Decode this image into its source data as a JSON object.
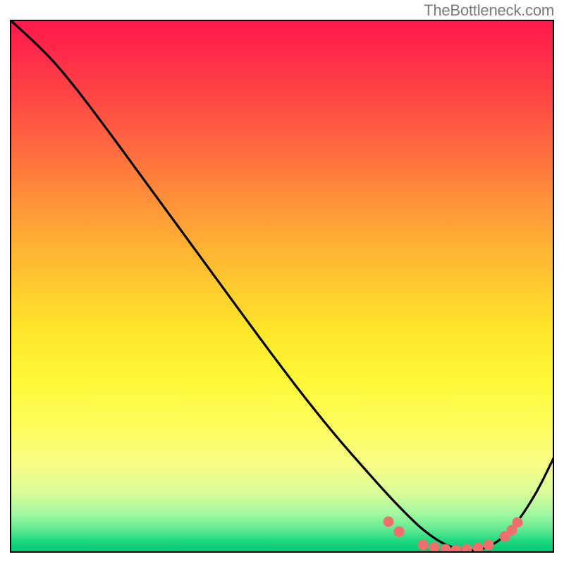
{
  "watermark": {
    "text": "TheBottleneck.com"
  },
  "colors": {
    "border": "#000000",
    "curve": "#000000",
    "dot": "#ef6f6d",
    "gradient_top": "#ff1a4a",
    "gradient_bottom": "#00c873"
  },
  "chart_data": {
    "type": "line",
    "title": "",
    "xlabel": "",
    "ylabel": "",
    "xlim": [
      0,
      100
    ],
    "ylim": [
      0,
      100
    ],
    "grid": false,
    "legend": false,
    "series": [
      {
        "name": "bottleneck-curve",
        "x": [
          0,
          4,
          7,
          10,
          14,
          18,
          22,
          27,
          32,
          38,
          45,
          52,
          58,
          63,
          67,
          71,
          75,
          79,
          83,
          86,
          89,
          92,
          95,
          98,
          100
        ],
        "y": [
          100,
          98,
          96,
          93,
          89,
          84,
          78,
          71,
          64,
          56,
          46,
          36,
          27,
          19,
          12,
          7,
          3,
          1,
          0,
          0,
          1,
          4,
          11,
          19,
          25
        ]
      }
    ],
    "markers": {
      "name": "highlight-dots",
      "points": [
        {
          "x": 69.5,
          "y": 5.8
        },
        {
          "x": 71.5,
          "y": 4.0
        },
        {
          "x": 76.0,
          "y": 1.5
        },
        {
          "x": 78.0,
          "y": 1.0
        },
        {
          "x": 80.0,
          "y": 0.7
        },
        {
          "x": 82.0,
          "y": 0.5
        },
        {
          "x": 84.0,
          "y": 0.6
        },
        {
          "x": 86.0,
          "y": 0.9
        },
        {
          "x": 88.0,
          "y": 1.4
        },
        {
          "x": 91.0,
          "y": 3.0
        },
        {
          "x": 92.2,
          "y": 4.2
        },
        {
          "x": 93.3,
          "y": 5.7
        }
      ]
    }
  }
}
